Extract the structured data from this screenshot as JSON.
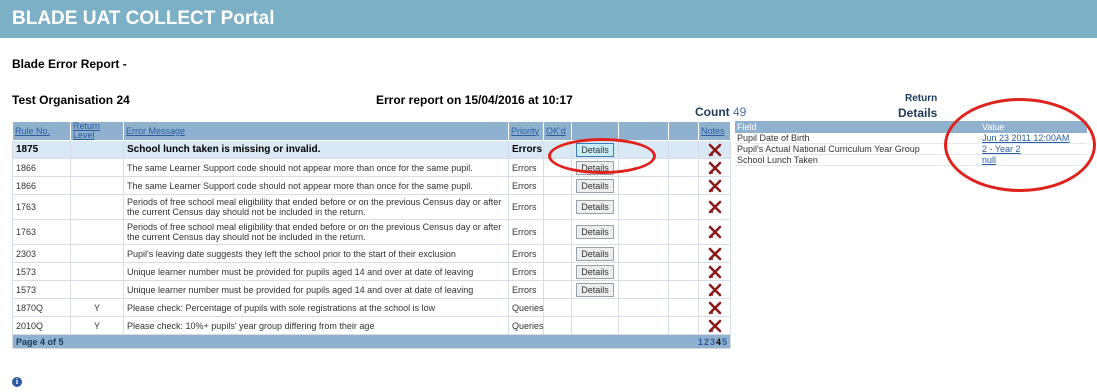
{
  "banner": {
    "title": "BLADE UAT COLLECT Portal"
  },
  "report": {
    "title": "Blade Error Report -",
    "organisation": "Test Organisation 24",
    "info": "Error report on 15/04/2016 at 10:17",
    "count_label": "Count",
    "count_value": "49",
    "return_label": "Return",
    "details_heading": "Details"
  },
  "grid": {
    "headers": {
      "rule": "Rule No.",
      "return_level": "Return Level",
      "message": "Error Message",
      "priority": "Priority",
      "okd": "OK'd",
      "notes": "Notes"
    },
    "rows": [
      {
        "rule": "1875",
        "level": "",
        "message": "School lunch taken is missing or invalid.",
        "priority": "Errors",
        "button": "Details"
      },
      {
        "rule": "1866",
        "level": "",
        "message": "The same Learner Support code should not appear more than once for the same pupil.",
        "priority": "Errors",
        "button": "Details"
      },
      {
        "rule": "1866",
        "level": "",
        "message": "The same Learner Support code should not appear more than once for the same pupil.",
        "priority": "Errors",
        "button": "Details"
      },
      {
        "rule": "1763",
        "level": "",
        "message": "Periods of free school meal eligibility that ended before or on the previous Census day or after the current Census day should not be included in the return.",
        "priority": "Errors",
        "button": "Details"
      },
      {
        "rule": "1763",
        "level": "",
        "message": "Periods of free school meal eligibility that ended before or on the previous Census day or after the current Census day should not be included in the return.",
        "priority": "Errors",
        "button": "Details"
      },
      {
        "rule": "2303",
        "level": "",
        "message": "Pupil's leaving date suggests they left the school prior to the start of their exclusion",
        "priority": "Errors",
        "button": "Details"
      },
      {
        "rule": "1573",
        "level": "",
        "message": "Unique learner number must be provided for pupils aged 14 and over at date of leaving",
        "priority": "Errors",
        "button": "Details"
      },
      {
        "rule": "1573",
        "level": "",
        "message": "Unique learner number must be provided for pupils aged 14 and over at date of leaving",
        "priority": "Errors",
        "button": "Details"
      },
      {
        "rule": "1870Q",
        "level": "Y",
        "message": "Please check:  Percentage of pupils with sole registrations at the school is low",
        "priority": "Queries",
        "button": ""
      },
      {
        "rule": "2010Q",
        "level": "Y",
        "message": "Please check:  10%+ pupils' year group differing from their age",
        "priority": "Queries",
        "button": ""
      }
    ],
    "footer": {
      "page_text": "Page 4 of 5",
      "pages": [
        "1",
        "2",
        "3",
        "4",
        "5"
      ],
      "current_page": "4"
    }
  },
  "detail": {
    "headers": {
      "field": "Field",
      "value": "Value"
    },
    "rows": [
      {
        "field": "Pupil Date of Birth",
        "value": "Jun 23 2011 12:00AM"
      },
      {
        "field": "Pupil's Actual National Curriculum Year Group",
        "value": "2 - Year 2"
      },
      {
        "field": "School Lunch Taken",
        "value": "null"
      }
    ]
  },
  "colors": {
    "banner": "#7cb0c6",
    "header": "#8fb0cf",
    "highlight": "#e0221c",
    "selected_row": "#d8e8f5"
  },
  "icons": {
    "notes": "delete-x-icon",
    "info": "info-icon"
  }
}
